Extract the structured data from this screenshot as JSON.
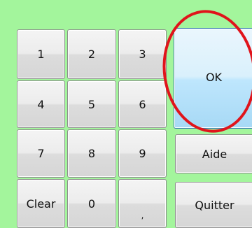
{
  "keypad": {
    "keys": {
      "k1": "1",
      "k2": "2",
      "k3": "3",
      "k4": "4",
      "k5": "5",
      "k6": "6",
      "k7": "7",
      "k8": "8",
      "k9": "9",
      "clear": "Clear",
      "k0": "0",
      "comma": ","
    }
  },
  "actions": {
    "ok": "OK",
    "help": "Aide",
    "quit": "Quitter"
  },
  "colors": {
    "background": "#a3f59c",
    "ok_border": "#3c7fb1",
    "annotation": "#e0141b"
  }
}
